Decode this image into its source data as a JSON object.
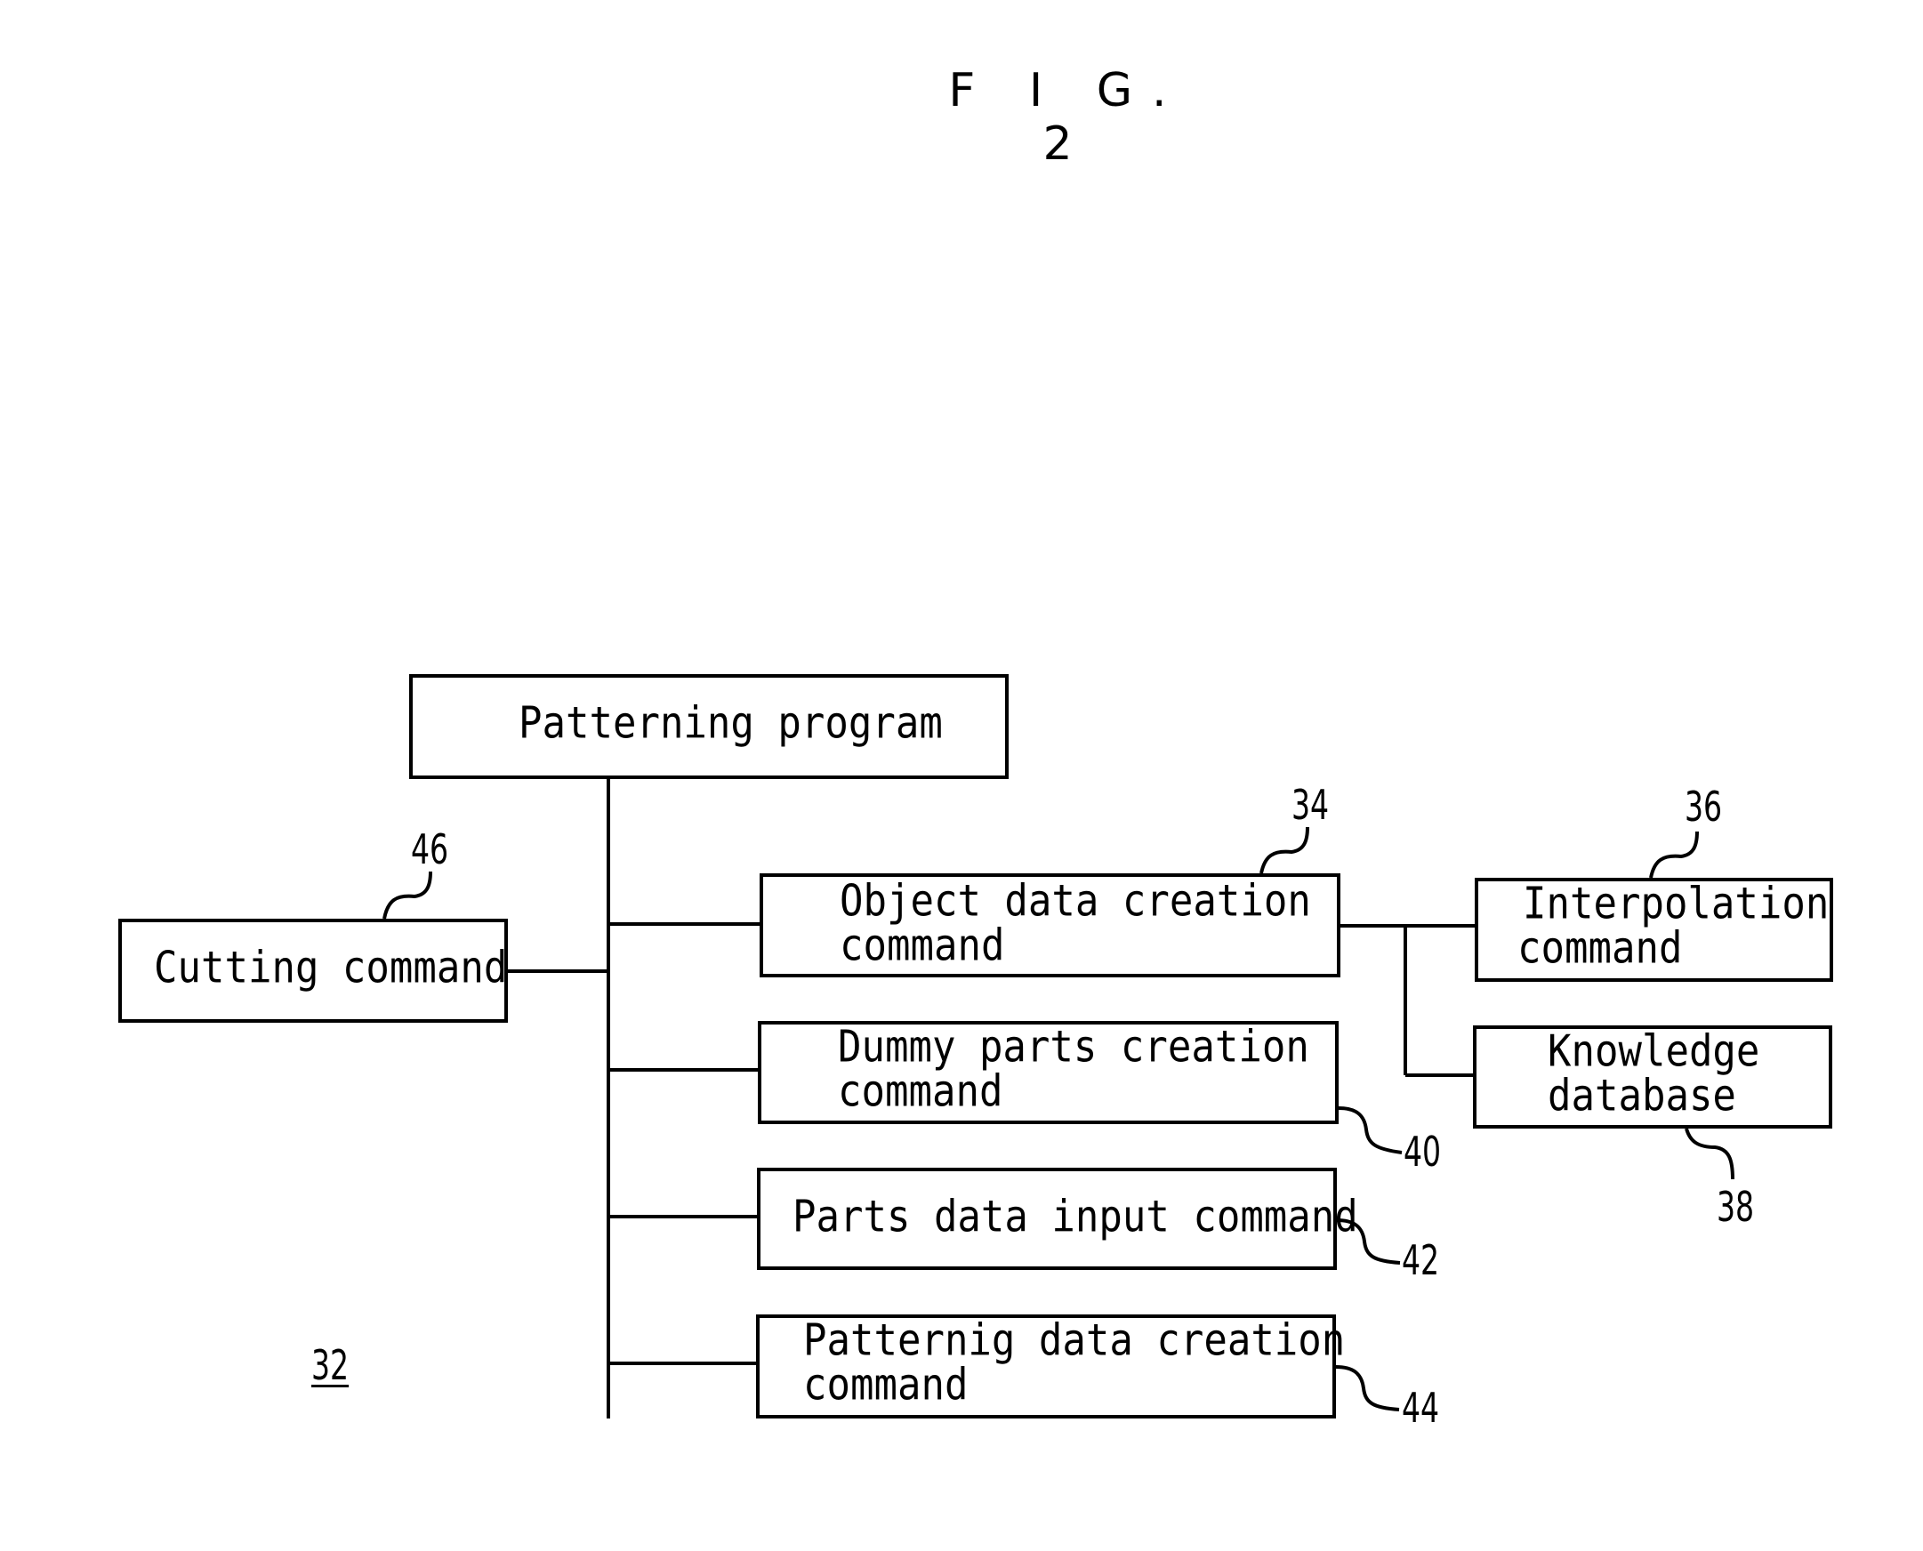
{
  "figure": {
    "title": "F I G. 2"
  },
  "boxes": {
    "root": {
      "line1": "Patterning program"
    },
    "cutting": {
      "line1": "Cutting command"
    },
    "object": {
      "line1": "Object data creation",
      "line2": "command"
    },
    "dummy": {
      "line1": "Dummy parts creation",
      "line2": "command"
    },
    "parts_input": {
      "line1": "Parts data input command"
    },
    "patterning_data": {
      "line1": "Patternig data creation",
      "line2": "command"
    },
    "interpolation": {
      "line1": "Interpolation",
      "line2": "command"
    },
    "knowledge": {
      "line1": "Knowledge",
      "line2": "database"
    }
  },
  "refs": {
    "object": "34",
    "interpolation": "36",
    "knowledge": "38",
    "dummy": "40",
    "parts_input": "42",
    "patterning_data": "44",
    "cutting": "46",
    "program": "32"
  }
}
